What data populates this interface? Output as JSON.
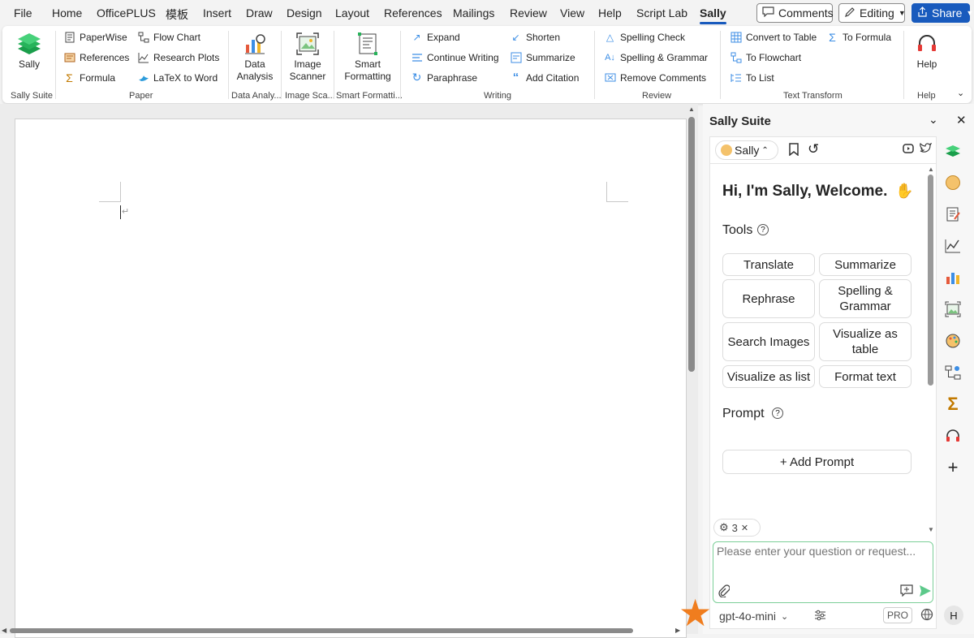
{
  "menu": {
    "tabs": [
      "File",
      "Home",
      "OfficePLUS",
      "模板",
      "Insert",
      "Draw",
      "Design",
      "Layout",
      "References",
      "Mailings",
      "Review",
      "View",
      "Help",
      "Script Lab",
      "Sally"
    ],
    "active": "Sally",
    "comments": "Comments",
    "editing": "Editing",
    "share": "Share"
  },
  "ribbon": {
    "sally": {
      "label": "Sally",
      "group": "Sally Suite"
    },
    "paper": {
      "group": "Paper",
      "items": [
        "PaperWise",
        "References",
        "Formula",
        "Flow Chart",
        "Research Plots",
        "LaTeX to Word"
      ]
    },
    "data": {
      "label": "Data Analysis",
      "group": "Data Analy..."
    },
    "image": {
      "label": "Image Scanner",
      "group": "Image Sca..."
    },
    "smart": {
      "label": "Smart Formatting",
      "group": "Smart Formatti..."
    },
    "writing": {
      "group": "Writing",
      "items": [
        "Expand",
        "Continue Writing",
        "Paraphrase",
        "Shorten",
        "Summarize",
        "Add Citation"
      ]
    },
    "review": {
      "group": "Review",
      "items": [
        "Spelling Check",
        "Spelling & Grammar",
        "Remove Comments"
      ]
    },
    "transform": {
      "group": "Text Transform",
      "items": [
        "Convert to Table",
        "To Flowchart",
        "To List",
        "To Formula"
      ]
    },
    "help": {
      "label": "Help",
      "group": "Help"
    }
  },
  "pane": {
    "title": "Sally Suite",
    "persona": "Sally",
    "welcome": "Hi, I'm Sally, Welcome.",
    "tools_heading": "Tools",
    "tools": [
      "Translate",
      "Summarize",
      "Rephrase",
      "Spelling & Grammar",
      "Search Images",
      "Visualize as table",
      "Visualize as list",
      "Format text"
    ],
    "prompt_heading": "Prompt",
    "add_prompt": "+ Add Prompt",
    "context_count": "3",
    "chat_placeholder": "Please enter your question or request...",
    "model": "gpt-4o-mini",
    "pro": "PRO",
    "avatar": "H"
  },
  "colors": {
    "accent": "#185abd",
    "chat_border": "#7ccf98",
    "send": "#5cc98a",
    "star": "#f07d1e"
  }
}
